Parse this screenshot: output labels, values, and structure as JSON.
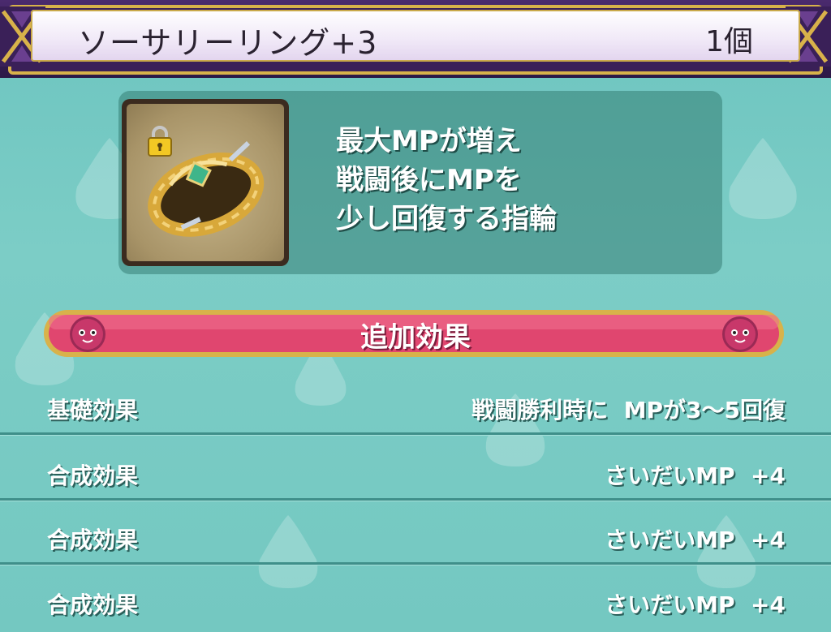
{
  "item": {
    "name": "ソーサリーリング+3",
    "count": "1個",
    "description": "最大MPが増え\n戦闘後にMPを\n少し回復する指輪",
    "icon": "ring-icon",
    "locked": true
  },
  "section": {
    "title": "追加効果"
  },
  "effects": [
    {
      "label": "基礎効果",
      "value": "戦闘勝利時に  MPが3〜5回復"
    },
    {
      "label": "合成効果",
      "value": "さいだいMP  +4"
    },
    {
      "label": "合成効果",
      "value": "さいだいMP  +4"
    },
    {
      "label": "合成効果",
      "value": "さいだいMP  +4"
    }
  ],
  "colors": {
    "background": "#74c8c1",
    "title_frame": "#3a2058",
    "gold": "#d8b24a",
    "banner": "#e0466f"
  }
}
